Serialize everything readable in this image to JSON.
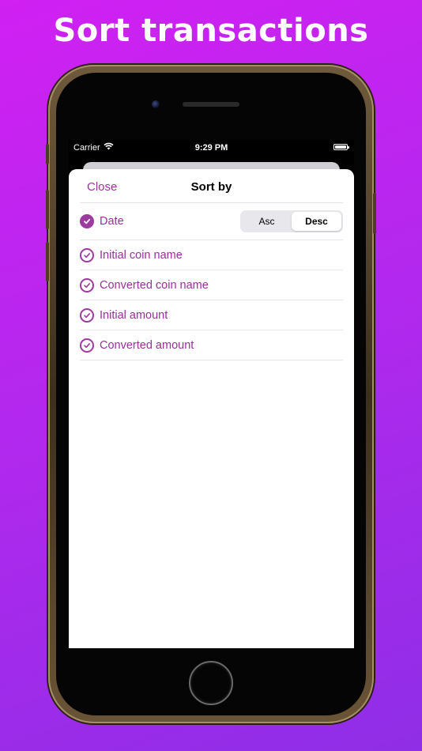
{
  "headline": "Sort transactions",
  "status_bar": {
    "carrier": "Carrier",
    "time": "9:29 PM"
  },
  "sheet": {
    "close_label": "Close",
    "title": "Sort by",
    "options": [
      {
        "label": "Date",
        "selected": true,
        "segments": [
          "Asc",
          "Desc"
        ],
        "selected_segment": "Desc"
      },
      {
        "label": "Initial coin name",
        "selected": false
      },
      {
        "label": "Converted coin name",
        "selected": false
      },
      {
        "label": "Initial amount",
        "selected": false
      },
      {
        "label": "Converted amount",
        "selected": false
      }
    ]
  },
  "colors": {
    "accent": "#9a2f9c",
    "background_start": "#d020f2",
    "background_end": "#8f2ee6"
  }
}
